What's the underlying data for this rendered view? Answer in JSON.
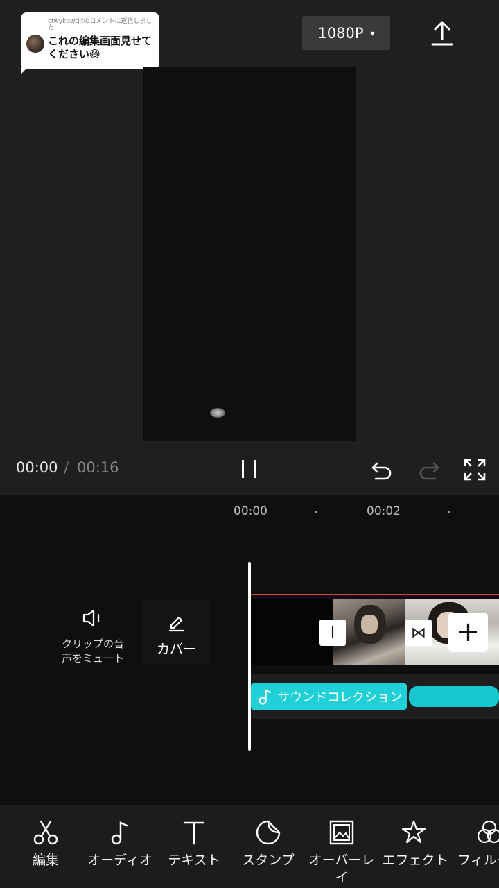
{
  "comment": {
    "meta": "ctwykpwtjjtのコメントに返信しました",
    "text": "これの編集画面見せてください😅"
  },
  "header": {
    "resolution": "1080P",
    "resolution_caret": "▾"
  },
  "playback": {
    "current_time": "00:00",
    "separator": "/",
    "total_time": "00:16"
  },
  "timeline": {
    "ruler": [
      "00:00",
      "00:02"
    ]
  },
  "track_actions": {
    "mute_label": "クリップの音声をミュート",
    "cover_label": "カバー"
  },
  "clip_controls": {
    "handle_label": "I",
    "transition_label": "⋈",
    "add_label": "+"
  },
  "audio": {
    "label": "サウンドコレクション",
    "color": "#1fd0d6"
  },
  "toolbar": {
    "items": [
      {
        "label": "編集",
        "icon": "scissors-icon"
      },
      {
        "label": "オーディオ",
        "icon": "music-note-icon"
      },
      {
        "label": "テキスト",
        "icon": "text-icon"
      },
      {
        "label": "スタンプ",
        "icon": "sticker-icon"
      },
      {
        "label": "オーバーレイ",
        "icon": "overlay-icon"
      },
      {
        "label": "エフェクト",
        "icon": "effects-star-icon"
      },
      {
        "label": "フィルター",
        "icon": "filter-icon"
      }
    ]
  }
}
